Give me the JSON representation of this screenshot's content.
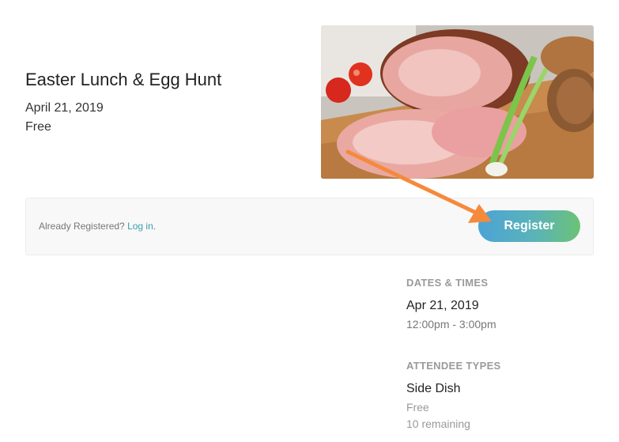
{
  "event": {
    "title": "Easter Lunch & Egg Hunt",
    "date": "April 21, 2019",
    "price": "Free"
  },
  "registration": {
    "already_text": "Already Registered?",
    "login_label": "Log in",
    "login_suffix": ".",
    "register_label": "Register",
    "accent_color": "#3aa0a8",
    "arrow_color": "#f58a3c"
  },
  "dates_times": {
    "heading": "DATES & TIMES",
    "date": "Apr 21, 2019",
    "time": "12:00pm - 3:00pm"
  },
  "attendee_types": {
    "heading": "ATTENDEE TYPES",
    "name": "Side Dish",
    "price": "Free",
    "remaining": "10 remaining"
  }
}
